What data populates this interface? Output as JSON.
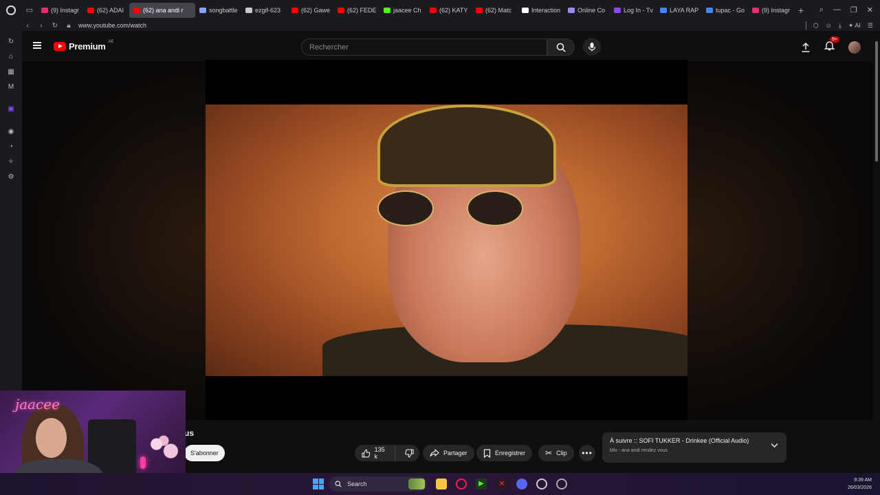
{
  "browser": {
    "tabs": [
      {
        "label": "(9) Instagr",
        "color": "#e1306c",
        "active": false
      },
      {
        "label": "(62) ADAI",
        "color": "#ff0000",
        "active": false
      },
      {
        "label": "(62) ana andi r",
        "color": "#ff0000",
        "active": true
      },
      {
        "label": "songbattle",
        "color": "#8aa0ff",
        "active": false
      },
      {
        "label": "ezgif-623",
        "color": "#cccccc",
        "active": false
      },
      {
        "label": "(62) Gawe",
        "color": "#ff0000",
        "active": false
      },
      {
        "label": "(62) FEDE",
        "color": "#ff0000",
        "active": false
      },
      {
        "label": "jaacee Ch",
        "color": "#53fc18",
        "active": false
      },
      {
        "label": "(62) KATY",
        "color": "#ff0000",
        "active": false
      },
      {
        "label": "(62) Matc",
        "color": "#ff0000",
        "active": false
      },
      {
        "label": "Interaction",
        "color": "#ffffff",
        "active": false
      },
      {
        "label": "Online Co",
        "color": "#9a8cff",
        "active": false
      },
      {
        "label": "Log In - Tv",
        "color": "#9146ff",
        "active": false
      },
      {
        "label": "LAYA RAP",
        "color": "#4285f4",
        "active": false
      },
      {
        "label": "tupac - Go",
        "color": "#4285f4",
        "active": false
      },
      {
        "label": "(9) Instagr",
        "color": "#e1306c",
        "active": false
      }
    ],
    "url": "www.youtube.com/watch",
    "ai_label": "AI"
  },
  "youtube": {
    "logo_word": "Premium",
    "country_code": "AE",
    "search_placeholder": "Rechercher",
    "notifications_badge": "9+"
  },
  "video": {
    "title_fragment": "us",
    "subscribe_label": "S'abonner",
    "like_count": "135 k",
    "share_label": "Partager",
    "save_label": "Enregistrer",
    "clip_label": "Clip"
  },
  "up_next": {
    "title": "À suivre :: SOFI TUKKER - Drinkee (Official Audio)",
    "subtitle": "Mix - ana andi rendez vous"
  },
  "webcam": {
    "neon_text": "jaacee"
  },
  "taskbar": {
    "search_label": "Search",
    "time": "9:39 AM",
    "date": "26/03/2026"
  }
}
